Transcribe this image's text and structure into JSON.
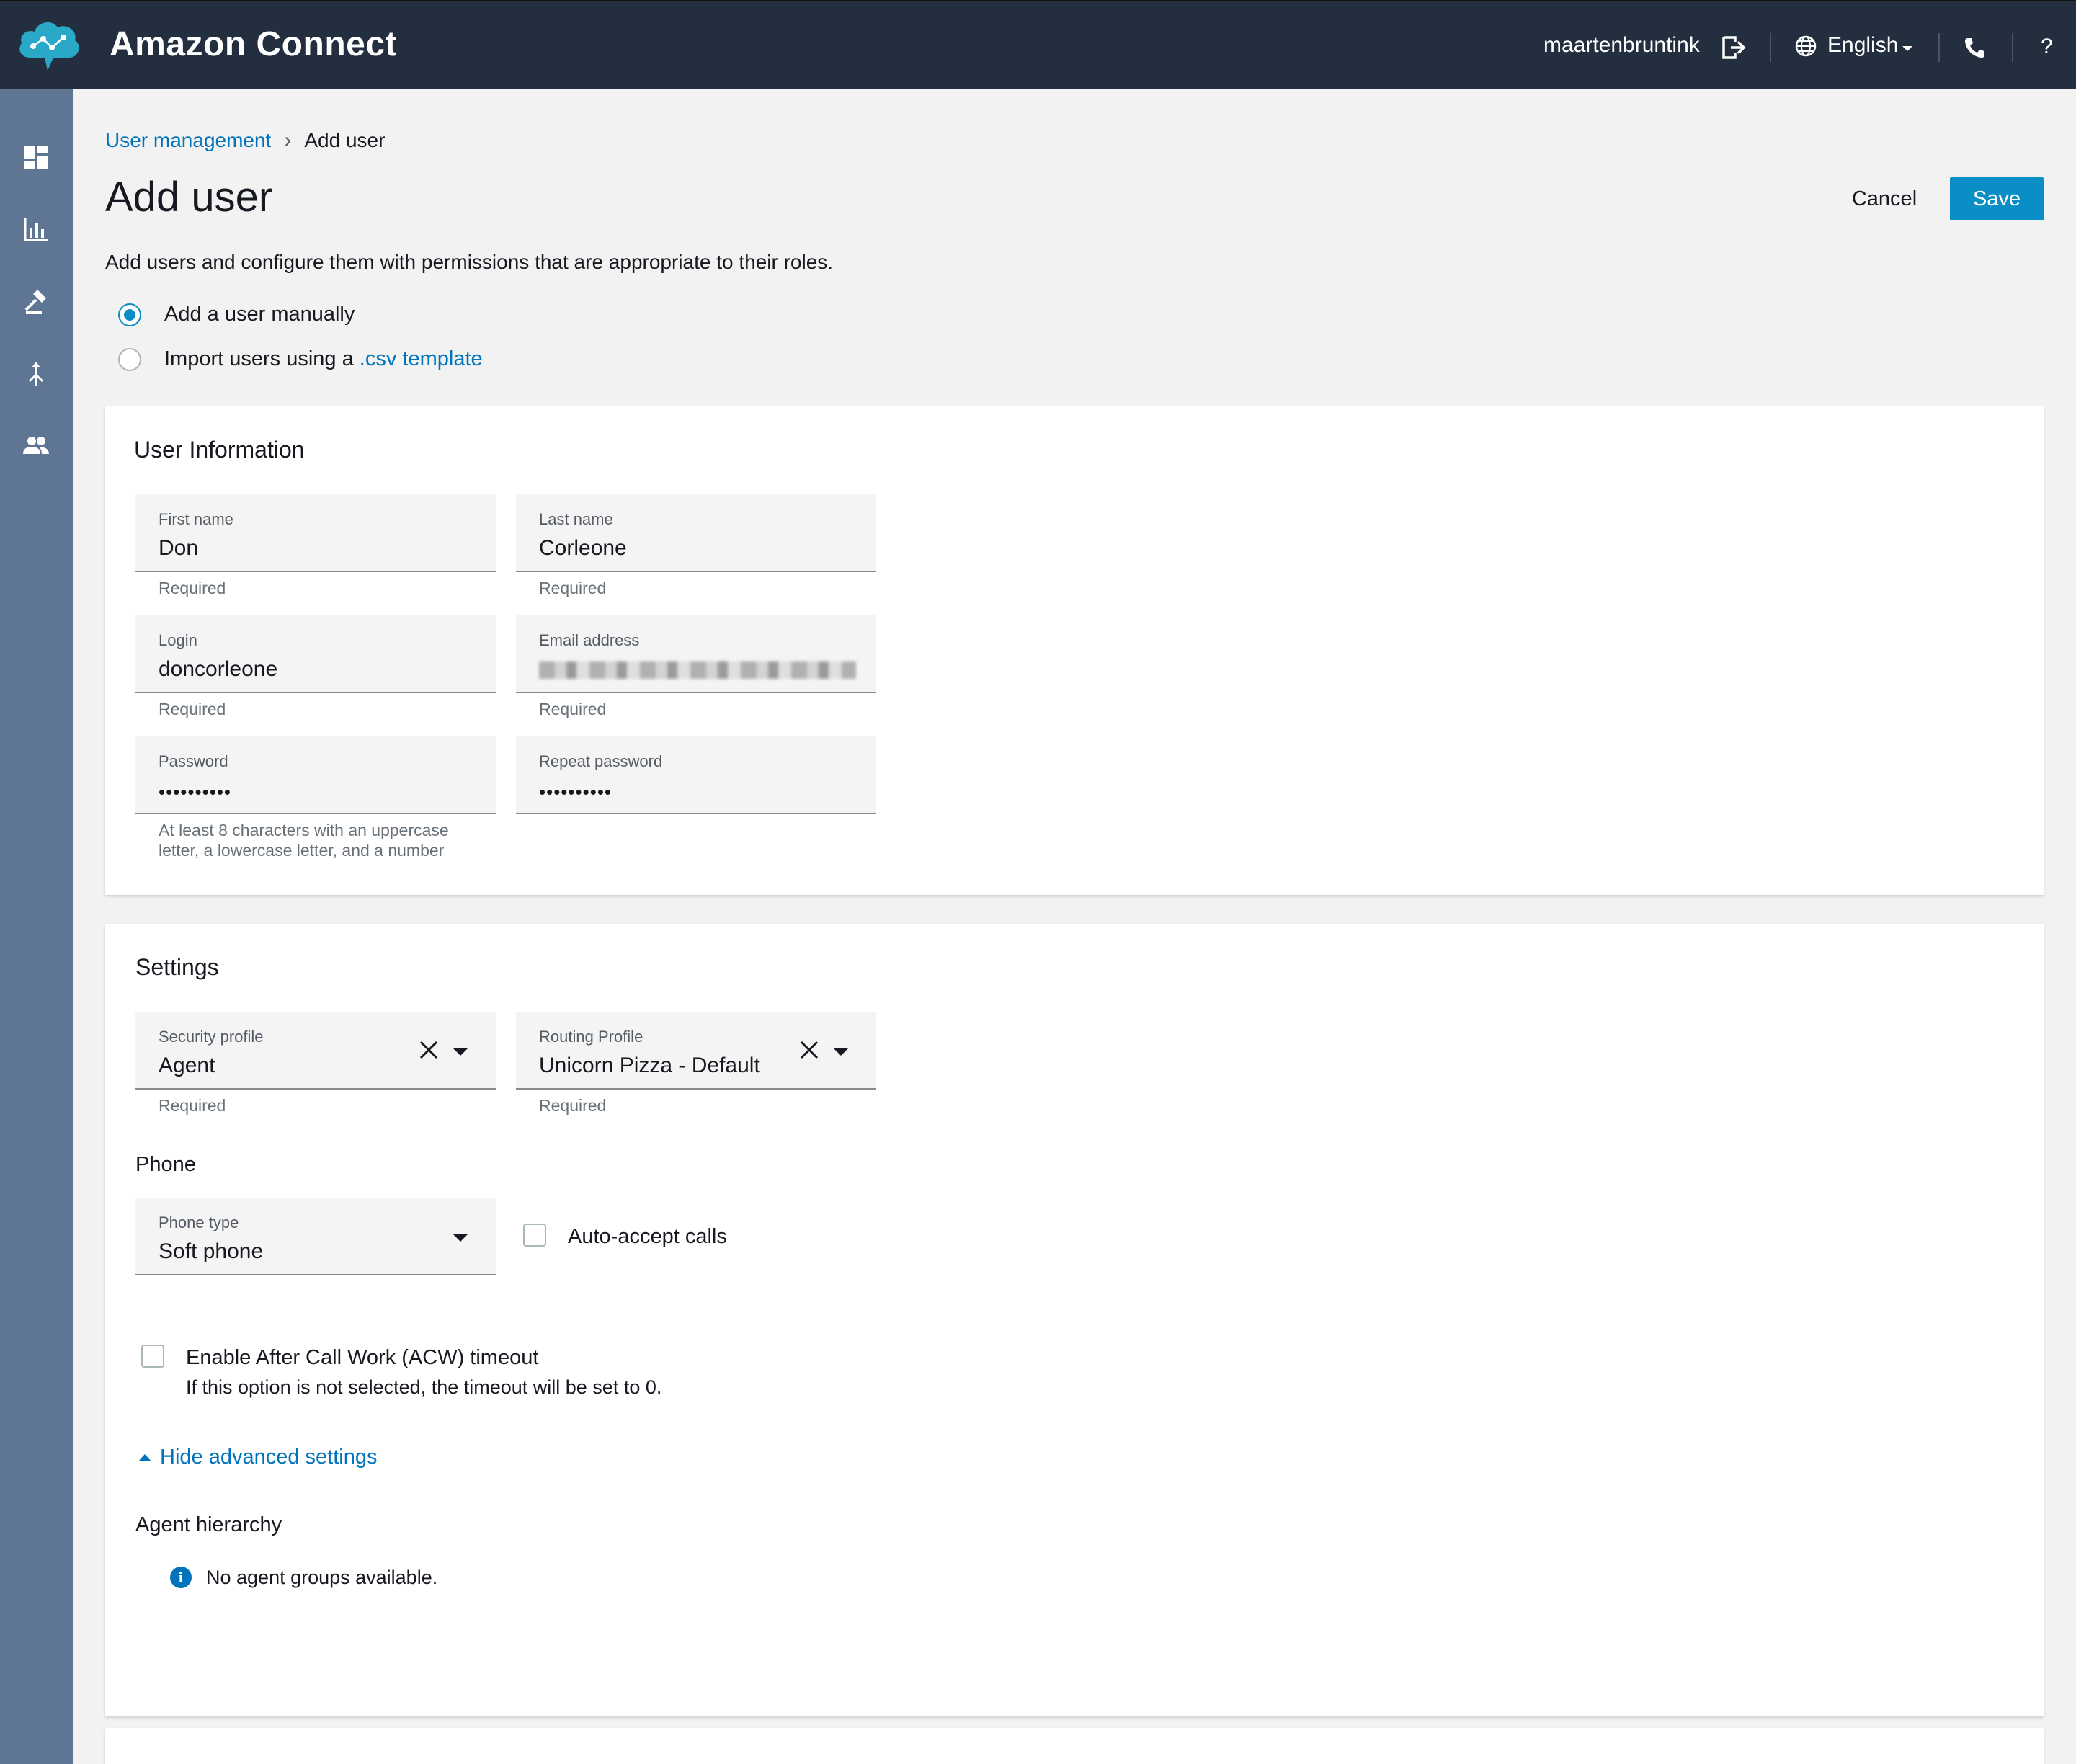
{
  "header": {
    "title": "Amazon Connect",
    "username": "maartenbruntink",
    "language": "English",
    "help": "?"
  },
  "sidebar": {
    "items": [
      {
        "icon": "dashboard-icon"
      },
      {
        "icon": "metrics-icon"
      },
      {
        "icon": "routing-icon"
      },
      {
        "icon": "channels-icon"
      },
      {
        "icon": "users-icon"
      }
    ]
  },
  "breadcrumb": {
    "parent": "User management",
    "separator": "›",
    "current": "Add user"
  },
  "page": {
    "title": "Add user",
    "cancel_label": "Cancel",
    "save_label": "Save",
    "description": "Add users and configure them with permissions that are appropriate to their roles."
  },
  "mode": {
    "manual_label": "Add a user manually",
    "import_prefix": "Import users using a ",
    "import_link": ".csv template",
    "selected": "manual"
  },
  "user_info": {
    "title": "User Information",
    "first_name": {
      "label": "First name",
      "value": "Don",
      "helper": "Required"
    },
    "last_name": {
      "label": "Last name",
      "value": "Corleone",
      "helper": "Required"
    },
    "login": {
      "label": "Login",
      "value": "doncorleone",
      "helper": "Required"
    },
    "email": {
      "label": "Email address",
      "helper": "Required"
    },
    "password": {
      "label": "Password",
      "value": "••••••••••",
      "helper_line1": "At least 8 characters with an uppercase",
      "helper_line2": "letter, a lowercase letter, and a number"
    },
    "repeat_password": {
      "label": "Repeat password",
      "value": "••••••••••"
    }
  },
  "settings": {
    "title": "Settings",
    "security_profile": {
      "label": "Security profile",
      "value": "Agent",
      "helper": "Required"
    },
    "routing_profile": {
      "label": "Routing Profile",
      "value": "Unicorn Pizza - Default",
      "helper": "Required"
    },
    "phone_heading": "Phone",
    "phone_type": {
      "label": "Phone type",
      "value": "Soft phone"
    },
    "auto_accept_label": "Auto-accept calls",
    "acw_label": "Enable After Call Work (ACW) timeout",
    "acw_note": "If this option is not selected, the timeout will be set to 0.",
    "advanced_toggle": "Hide advanced settings",
    "hierarchy_heading": "Agent hierarchy",
    "hierarchy_note": "No agent groups available."
  },
  "colors": {
    "header_bg": "#232f3e",
    "sidebar_bg": "#5f7594",
    "accent": "#0a8ec6",
    "link": "#0073bb"
  }
}
